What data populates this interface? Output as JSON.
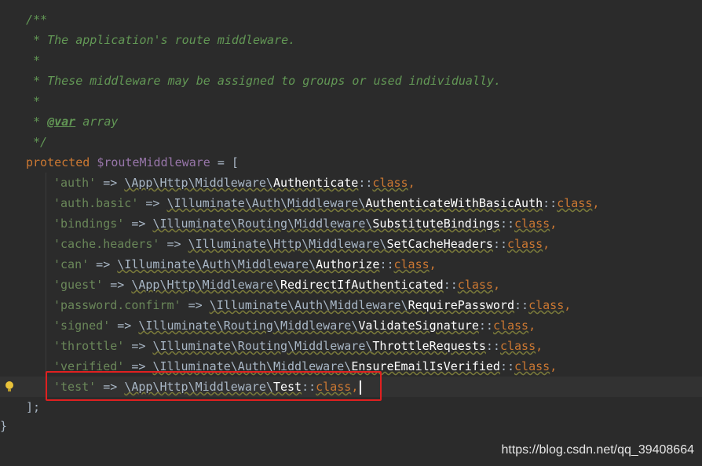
{
  "doc_comment": {
    "open": "/**",
    "line1": " * The application's route middleware.",
    "line2": " *",
    "line3": " * These middleware may be assigned to groups or used individually.",
    "line4": " *",
    "line5_prefix": " * ",
    "line5_tag": "@var",
    "line5_type": " array",
    "close": " */"
  },
  "declaration": {
    "keyword": "protected",
    "variable": "$routeMiddleware",
    "assign": " = ["
  },
  "entries": [
    {
      "key": "'auth'",
      "arrow": " => ",
      "ns": "\\App\\Http\\Middleware\\",
      "cls": "Authenticate",
      "sep": "::",
      "classkw": "class",
      "comma": ","
    },
    {
      "key": "'auth.basic'",
      "arrow": " => ",
      "ns": "\\Illuminate\\Auth\\Middleware\\",
      "cls": "AuthenticateWithBasicAuth",
      "sep": "::",
      "classkw": "class",
      "comma": ","
    },
    {
      "key": "'bindings'",
      "arrow": " => ",
      "ns": "\\Illuminate\\Routing\\Middleware\\",
      "cls": "SubstituteBindings",
      "sep": "::",
      "classkw": "class",
      "comma": ","
    },
    {
      "key": "'cache.headers'",
      "arrow": " => ",
      "ns": "\\Illuminate\\Http\\Middleware\\",
      "cls": "SetCacheHeaders",
      "sep": "::",
      "classkw": "class",
      "comma": ","
    },
    {
      "key": "'can'",
      "arrow": " => ",
      "ns": "\\Illuminate\\Auth\\Middleware\\",
      "cls": "Authorize",
      "sep": "::",
      "classkw": "class",
      "comma": ","
    },
    {
      "key": "'guest'",
      "arrow": " => ",
      "ns": "\\App\\Http\\Middleware\\",
      "cls": "RedirectIfAuthenticated",
      "sep": "::",
      "classkw": "class",
      "comma": ","
    },
    {
      "key": "'password.confirm'",
      "arrow": " => ",
      "ns": "\\Illuminate\\Auth\\Middleware\\",
      "cls": "RequirePassword",
      "sep": "::",
      "classkw": "class",
      "comma": ","
    },
    {
      "key": "'signed'",
      "arrow": " => ",
      "ns": "\\Illuminate\\Routing\\Middleware\\",
      "cls": "ValidateSignature",
      "sep": "::",
      "classkw": "class",
      "comma": ","
    },
    {
      "key": "'throttle'",
      "arrow": " => ",
      "ns": "\\Illuminate\\Routing\\Middleware\\",
      "cls": "ThrottleRequests",
      "sep": "::",
      "classkw": "class",
      "comma": ","
    },
    {
      "key": "'verified'",
      "arrow": " => ",
      "ns": "\\Illuminate\\Auth\\Middleware\\",
      "cls": "EnsureEmailIsVerified",
      "sep": "::",
      "classkw": "class",
      "comma": ","
    },
    {
      "key": "'test'",
      "arrow": " => ",
      "ns": "\\App\\Http\\Middleware\\",
      "cls": "Test",
      "sep": "::",
      "classkw": "class",
      "comma": ","
    }
  ],
  "array_close": "];",
  "class_close": "}",
  "watermark": "https://blog.csdn.net/qq_39408664",
  "colors": {
    "background": "#2b2b2b",
    "keyword": "#cc7832",
    "string": "#6a8759",
    "doc_comment": "#629755",
    "variable": "#9876aa",
    "highlight_box": "#e02020"
  }
}
